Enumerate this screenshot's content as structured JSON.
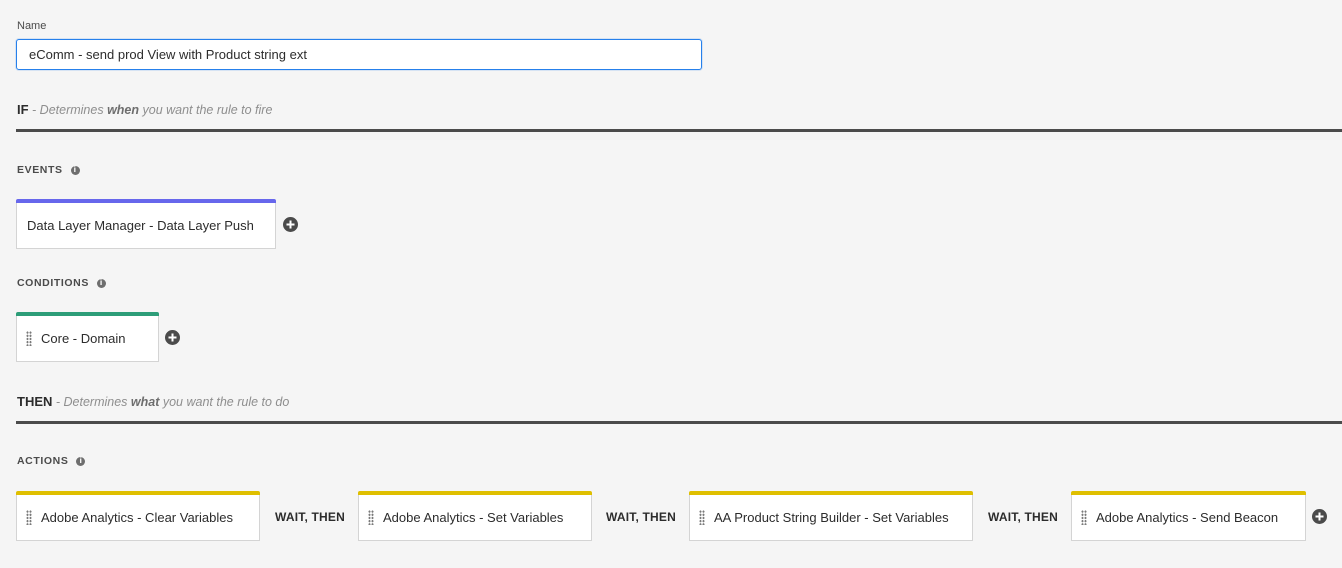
{
  "name_field": {
    "label": "Name",
    "value": "eComm - send prod View with Product string ext"
  },
  "if_section": {
    "keyword": "IF",
    "desc_pre": " - Determines ",
    "desc_strong": "when",
    "desc_post": " you want the rule to fire"
  },
  "events": {
    "label": "EVENTS",
    "items": [
      {
        "label": "Data Layer Manager - Data Layer Push"
      }
    ]
  },
  "conditions": {
    "label": "CONDITIONS",
    "items": [
      {
        "label": "Core - Domain"
      }
    ]
  },
  "then_section": {
    "keyword": "THEN",
    "desc_pre": " - Determines ",
    "desc_strong": "what",
    "desc_post": " you want the rule to do"
  },
  "actions": {
    "label": "ACTIONS",
    "separator": "WAIT, THEN",
    "items": [
      {
        "label": "Adobe Analytics - Clear Variables"
      },
      {
        "label": "Adobe Analytics - Set Variables"
      },
      {
        "label": "AA Product String Builder - Set Variables"
      },
      {
        "label": "Adobe Analytics - Send Beacon"
      }
    ]
  },
  "colors": {
    "event_bar": "#6767ec",
    "condition_bar": "#2d9d78",
    "action_bar": "#dfbf00",
    "section_rule": "#4b4b4b",
    "focus_border": "#2680eb"
  },
  "icons": {
    "info": "info-icon",
    "add": "plus-circle-icon",
    "drag": "drag-handle-icon"
  }
}
